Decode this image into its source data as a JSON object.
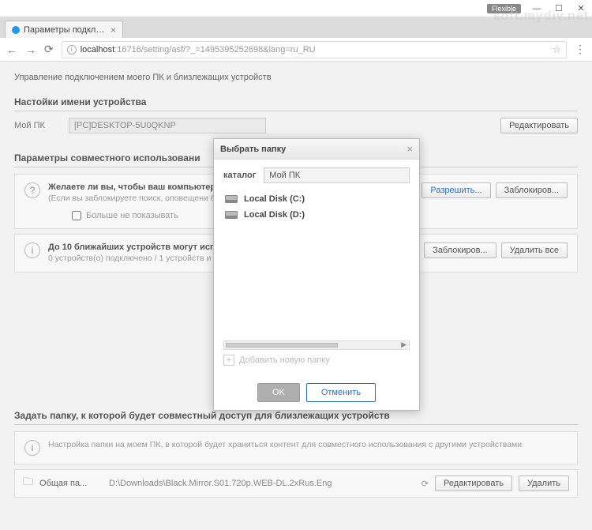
{
  "window": {
    "flexible": "Flexible",
    "watermark": "soft.mydiv.net"
  },
  "browser": {
    "tab_title": "Параметры подключен",
    "url_host": "localhost",
    "url_rest": ":16716/setting/asf/?_=1495395252698&lang=ru_RU"
  },
  "page": {
    "description": "Управление подключением моего ПК и близлежащих устройств",
    "device_name_section": "Настойки имени устройства",
    "device_label": "Мой ПК",
    "device_value": "[PC]DESKTOP-5U0QKNP",
    "edit_btn": "Редактировать",
    "sharing_section": "Параметры совместного использовани",
    "prompt_title": "Желаете ли вы, чтобы ваш компьютер",
    "prompt_sub": "(Если вы заблокируете поиск, оповещени\nблизлежащих устройств, не будет появлят",
    "dont_show": "Больше не показывать",
    "allow_btn": "Разрешить...",
    "block_btn": "Заблокиров...",
    "devices_title": "До 10 ближайших устройств могут исп",
    "devices_sub": "0 устройств(о) подключено / 1 устройств и",
    "block_btn2": "Заблокиров...",
    "delete_all": "Удалить все",
    "folder_section": "Задать папку, к которой будет совместный доступ для близлежащих устройств",
    "folder_desc": "Настройка папки на моем ПК, в которой будет храниться контент для совместного использования с другими устройствами",
    "folder_name": "Общая па...",
    "folder_path": "D:\\Downloads\\Black.Mirror.S01.720p.WEB-DL.2xRus.Eng",
    "edit_btn2": "Редактировать",
    "delete_btn": "Удалить"
  },
  "modal": {
    "title": "Выбрать папку",
    "catalog_label": "каталог",
    "catalog_value": "Мой ПК",
    "drives": [
      {
        "label": "Local Disk (C:)"
      },
      {
        "label": "Local Disk (D:)"
      }
    ],
    "add_folder": "Добавить новую папку",
    "ok": "OK",
    "cancel": "Отменить"
  }
}
